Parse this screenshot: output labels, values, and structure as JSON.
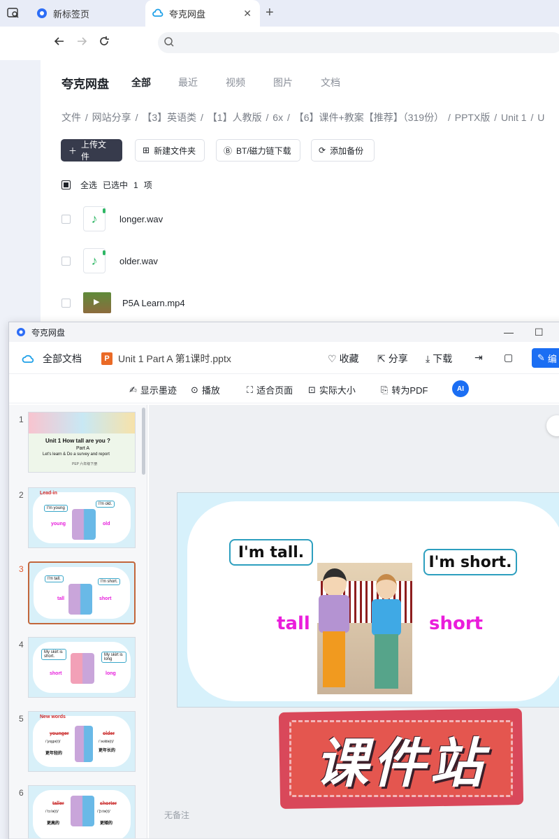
{
  "browser": {
    "tabs": [
      {
        "label": "新标签页"
      },
      {
        "label": "夸克网盘"
      }
    ],
    "close_label": "✕",
    "new_tab_label": "+"
  },
  "pan": {
    "brand": "夸克网盘",
    "nav": [
      "全部",
      "最近",
      "视频",
      "图片",
      "文档"
    ],
    "breadcrumb": [
      "文件",
      "/",
      "网站分享",
      "/",
      "【3】英语类",
      "/",
      "【1】人教版",
      "/",
      "6x",
      "/",
      "【6】课件+教案【推荐】（319份）",
      "/",
      "PPTX版",
      "/",
      "Unit 1",
      "/",
      "U"
    ],
    "buttons": {
      "upload": "上传文件",
      "new_folder": "新建文件夹",
      "bt": "BT/磁力链下载",
      "backup": "添加备份"
    },
    "select": {
      "all": "全选",
      "selected": "已选中",
      "count": "1",
      "unit": "项"
    },
    "files": [
      {
        "name": "longer.wav"
      },
      {
        "name": "older.wav"
      },
      {
        "name": "P5A Learn.mp4"
      }
    ]
  },
  "viewer": {
    "window_title": "夸克网盘",
    "all_docs": "全部文档",
    "file_title": "Unit 1 Part A 第1课时.pptx",
    "ppt_icon": "P",
    "actions": {
      "favorite": "收藏",
      "share": "分享",
      "download": "下载",
      "edit": "编"
    },
    "tools": {
      "ink": "显示墨迹",
      "play": "播放",
      "fit": "适合页面",
      "actual": "实际大小",
      "pdf": "转为PDF",
      "ai": "AI"
    },
    "notes": "无备注",
    "thumbnails": [
      {
        "num": "1",
        "title": "Unit 1  How tall are you ?",
        "sub": "Part A",
        "sub2": "Let's learn & Do a survey and report",
        "foot": "PEP 六年级下册"
      },
      {
        "num": "2",
        "header": "Lead-in",
        "b1": "I'm young",
        "b2": "I'm old.",
        "w1": "young",
        "w2": "old"
      },
      {
        "num": "3",
        "b1": "I'm tall.",
        "b2": "I'm short.",
        "w1": "tall",
        "w2": "short"
      },
      {
        "num": "4",
        "b1": "My skirt is short.",
        "b2": "My skirt is long",
        "w1": "short",
        "w2": "long"
      },
      {
        "num": "5",
        "header": "New words",
        "w1": "younger",
        "w2": "older",
        "p1": "/ˈjʌŋɡə(r)/",
        "p2": "/ˈəʊldə(r)/",
        "c1": "更年轻的",
        "c2": "更年长的"
      },
      {
        "num": "6",
        "w1": "taller",
        "w2": "shorter",
        "p1": "/ˈtɔːlə(r)/",
        "p2": "/ˈʃɔːtə(r)/",
        "c1": "更高的",
        "c2": "更矮的"
      }
    ],
    "slide": {
      "bubble_left": "I'm tall.",
      "bubble_right": "I'm short.",
      "word_left": "tall",
      "word_right": "short"
    },
    "watermark": "课件站"
  }
}
